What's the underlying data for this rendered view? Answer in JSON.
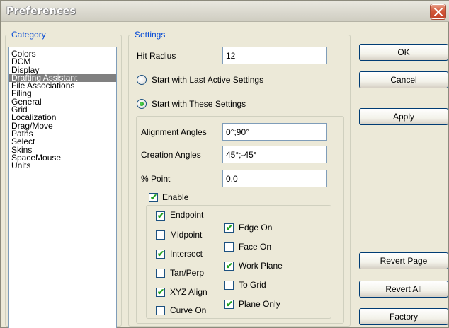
{
  "window": {
    "title": "Preferences"
  },
  "category": {
    "legend": "Category",
    "items": [
      "Colors",
      "DCM",
      "Display",
      "Drafting Assistant",
      "File Associations",
      "Filing",
      "General",
      "Grid",
      "Localization",
      "Drag/Move",
      "Paths",
      "Select",
      "Skins",
      "SpaceMouse",
      "Units"
    ],
    "selected": "Drafting Assistant"
  },
  "settings": {
    "legend": "Settings",
    "hit_radius_label": "Hit Radius",
    "hit_radius_value": "12",
    "radio_last": {
      "label": "Start with Last Active Settings",
      "checked": false
    },
    "radio_these": {
      "label": "Start with These Settings",
      "checked": true
    },
    "alignment_angles_label": "Alignment Angles",
    "alignment_angles_value": "0°;90°",
    "creation_angles_label": "Creation Angles",
    "creation_angles_value": "45°;-45°",
    "percent_point_label": "% Point",
    "percent_point_value": "0.0",
    "enable": {
      "label": "Enable",
      "checked": true
    },
    "left_checks": [
      {
        "label": "Endpoint",
        "checked": true
      },
      {
        "label": "Midpoint",
        "checked": false
      },
      {
        "label": "Intersect",
        "checked": true
      },
      {
        "label": "Tan/Perp",
        "checked": false
      },
      {
        "label": "XYZ Align",
        "checked": true
      },
      {
        "label": "Curve On",
        "checked": false
      }
    ],
    "right_checks": [
      {
        "label": "Edge On",
        "checked": true
      },
      {
        "label": "Face On",
        "checked": false
      },
      {
        "label": "Work Plane",
        "checked": true
      },
      {
        "label": "To Grid",
        "checked": false
      },
      {
        "label": "Plane Only",
        "checked": true
      }
    ]
  },
  "buttons": {
    "ok": "OK",
    "cancel": "Cancel",
    "apply": "Apply",
    "revert_page": "Revert Page",
    "revert_all": "Revert All",
    "factory": "Factory"
  },
  "colors": {
    "legend_blue": "#0046d5",
    "selected_bg": "#808080",
    "check_green": "#21a121",
    "close_red": "#c4432a"
  }
}
